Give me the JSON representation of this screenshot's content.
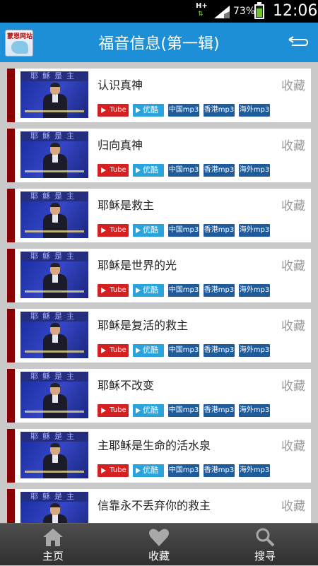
{
  "status": {
    "network": "H+",
    "battery_pct": "73%",
    "battery_level": 0.73,
    "time": "12:06"
  },
  "header": {
    "logo_text": "蒙恩网站",
    "title": "福音信息(第一辑)",
    "back_icon": "back-arrow-icon"
  },
  "buttons": {
    "youtube": "Tube",
    "youku": "优酷",
    "mp3_china": "中国mp3",
    "mp3_hk": "香港mp3",
    "mp3_overseas": "海外mp3"
  },
  "items": [
    {
      "title": "认识真神",
      "fav": "收藏",
      "thumb_banner": "耶稣是主"
    },
    {
      "title": "归向真神",
      "fav": "收藏",
      "thumb_banner": "耶稣是主"
    },
    {
      "title": "耶稣是救主",
      "fav": "收藏",
      "thumb_banner": "耶稣是主"
    },
    {
      "title": "耶稣是世界的光",
      "fav": "收藏",
      "thumb_banner": "耶稣是主"
    },
    {
      "title": "耶稣是复活的救主",
      "fav": "收藏",
      "thumb_banner": "耶稣是主"
    },
    {
      "title": "耶稣不改变",
      "fav": "收藏",
      "thumb_banner": "耶稣是主"
    },
    {
      "title": "主耶稣是生命的活水泉",
      "fav": "收藏",
      "thumb_banner": "耶稣是主"
    },
    {
      "title": "信靠永不丢弃你的救主",
      "fav": "收藏",
      "thumb_banner": "耶稣是主"
    }
  ],
  "tabs": [
    {
      "label": "主页",
      "icon": "home-icon"
    },
    {
      "label": "收藏",
      "icon": "heart-icon"
    },
    {
      "label": "搜寻",
      "icon": "search-icon"
    }
  ],
  "colors": {
    "accent": "#1d8fd6",
    "card_stripe": "#8a0000",
    "youtube_red": "#d42020",
    "youku_blue": "#2aa3dc",
    "mp3_blue": "#1f5a99"
  }
}
